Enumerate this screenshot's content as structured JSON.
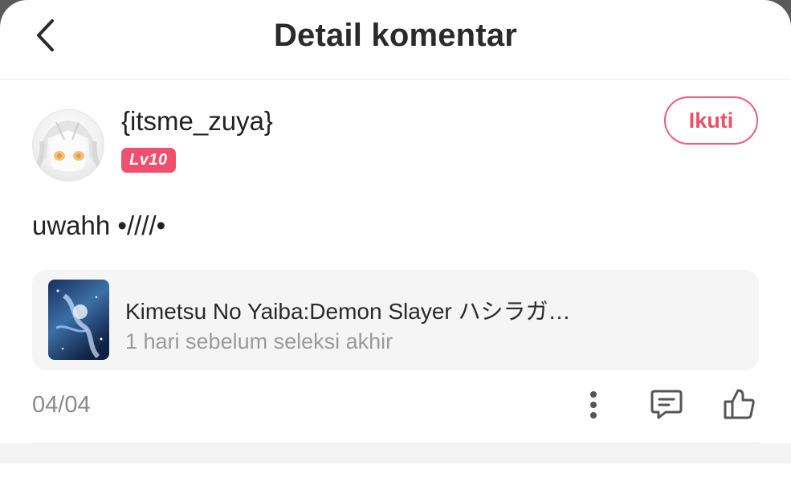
{
  "header": {
    "title": "Detail komentar",
    "back_icon": "chevron-left-icon"
  },
  "comment": {
    "username": "{itsme_zuya}",
    "level": "Lv10",
    "follow_label": "Ikuti",
    "text": "uwahh •////•",
    "date": "04/04"
  },
  "linked_work": {
    "title": "Kimetsu No Yaiba:Demon Slayer ハシラガ…",
    "subtitle": "1 hari sebelum seleksi akhir"
  },
  "actions": {
    "more_icon": "more-vertical-icon",
    "reply_icon": "comment-icon",
    "like_icon": "thumbs-up-icon"
  },
  "colors": {
    "accent": "#f0506e",
    "follow_border": "#e8607a",
    "muted_text": "#9a9a9a",
    "card_bg": "#f5f5f5"
  }
}
